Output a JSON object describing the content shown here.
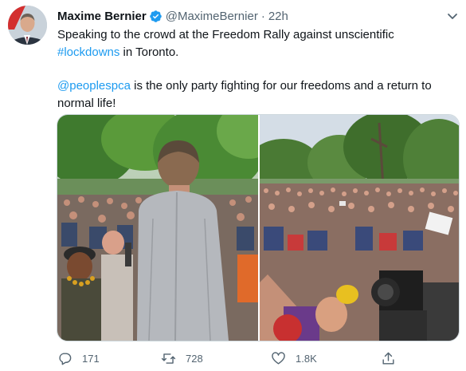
{
  "tweet": {
    "author_name": "Maxime Bernier",
    "handle": "@MaximeBernier",
    "separator": "·",
    "time": "22h",
    "text_line1_a": "Speaking to the crowd at the Freedom Rally against unscientific ",
    "hashtag": "#lockdowns",
    "text_line1_b": " in Toronto.",
    "mention": "@peoplespca",
    "text_line2": " is the only party fighting for our freedoms and a return to normal life!"
  },
  "actions": {
    "reply_count": "171",
    "retweet_count": "728",
    "like_count": "1.8K"
  },
  "colors": {
    "link": "#1d9bf0",
    "verified": "#1d9bf0",
    "secondary_text": "#536471"
  },
  "icons": [
    "verified-badge-icon",
    "more-caret-icon",
    "reply-icon",
    "retweet-icon",
    "like-icon",
    "share-icon"
  ]
}
